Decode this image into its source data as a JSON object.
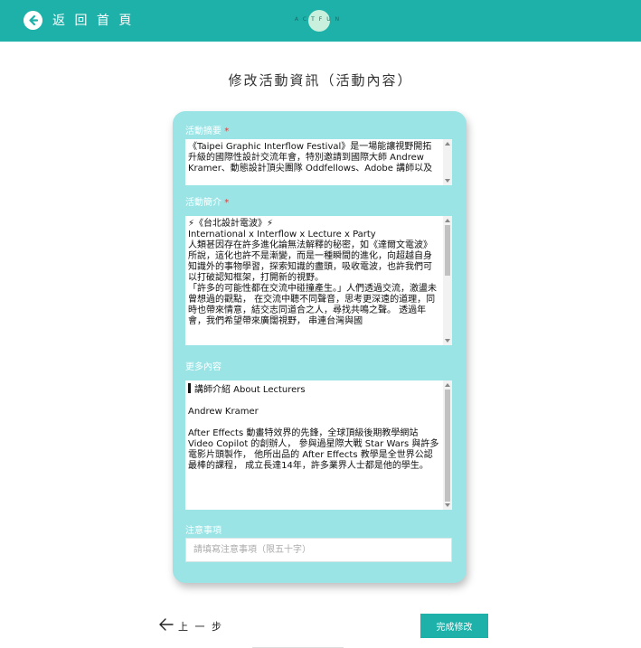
{
  "header": {
    "back_label": "返 回 首 頁",
    "logo_text": "ACTFUN",
    "accent_color": "#1db1aa",
    "back_icon": "arrow-left-circle-icon"
  },
  "page": {
    "title": "修改活動資訊（活動內容）"
  },
  "form": {
    "summary": {
      "label": "活動摘要",
      "required_mark": "*",
      "value": "《Taipei Graphic Interflow Festival》是一場能讓視野開拓升級的國際性設計交流年會，特別邀請到國際大師 Andrew Kramer、動態設計頂尖團隊 Oddfellows、Adobe 講師以及"
    },
    "intro": {
      "label": "活動簡介",
      "required_mark": "*",
      "value": "⚡《台北設計電波》⚡\nInternational x Interflow x Lecture x Party\n人類甚因存在許多進化論無法解釋的秘密，如《達爾文電波》所說，這化也許不是漸變，而是一種瞬間的進化，向超越自身知識外的事物學習，探索知識的盡頭，吸收電波，也許我們可以打破認知框架，打開新的視野。\n「許多的可能性都在交流中碰撞產生。」人們透過交流，激盪未曾想過的觀點， 在交流中聽不同聲音，思考更深遠的道理，同時也帶來情意，結交志同道合之人，尋找共鳴之聲。 透過年會，我們希望帶來廣闊視野， 串連台灣與國"
    },
    "more": {
      "label": "更多內容",
      "heading": "講師介紹 About Lecturers",
      "value": "\nAndrew Kramer\n\nAfter Effects 動畫特效界的先鋒，全球頂級後期教學網站 Video Copilot 的創辦人， 參與過星際大戰 Star Wars 與許多電影片頭製作， 他所出品的 After Effects 教學是全世界公認最棒的課程， 成立長達14年，許多業界人士都是他的學生。"
    },
    "notice": {
      "label": "注意事項",
      "placeholder": "請填寫注意事項（限五十字）",
      "value": ""
    }
  },
  "footer": {
    "prev_label": "上 一 步",
    "prev_icon": "arrow-left-icon",
    "submit_label": "完成修改"
  }
}
